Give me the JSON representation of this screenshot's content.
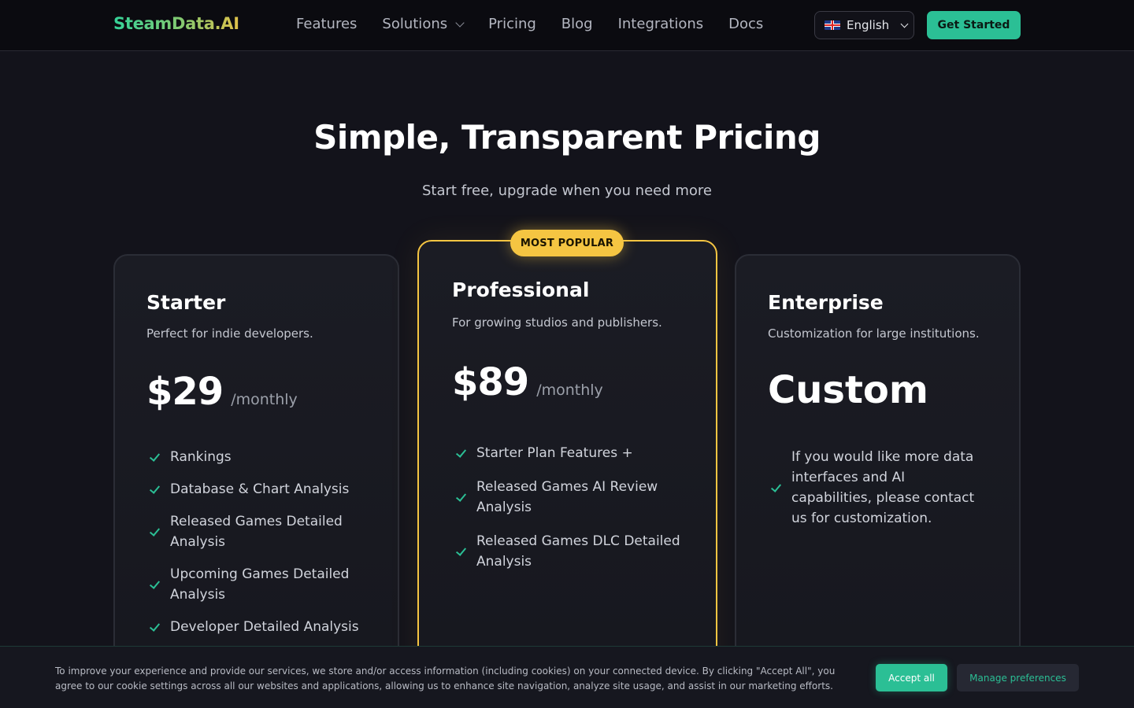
{
  "nav": {
    "logo": "SteamData.AI",
    "links": [
      "Features",
      "Solutions",
      "Pricing",
      "Blog",
      "Integrations",
      "Docs"
    ],
    "language": "English",
    "cta": "Get Started"
  },
  "hero": {
    "title": "Simple, Transparent Pricing",
    "subtitle": "Start free, upgrade when you need more"
  },
  "plans": {
    "starter": {
      "name": "Starter",
      "description": "Perfect for indie developers.",
      "price": "$29",
      "period": "/monthly",
      "features": [
        "Rankings",
        "Database & Chart Analysis",
        "Released Games Detailed Analysis",
        "Upcoming Games Detailed Analysis",
        "Developer Detailed Analysis"
      ]
    },
    "professional": {
      "badge": "MOST POPULAR",
      "name": "Professional",
      "description": "For growing studios and publishers.",
      "price": "$89",
      "period": "/monthly",
      "features": [
        "Starter Plan Features +",
        "Released Games AI Review Analysis",
        "Released Games DLC Detailed Analysis"
      ]
    },
    "enterprise": {
      "name": "Enterprise",
      "description": "Customization for large institutions.",
      "price": "Custom",
      "features": [
        "If you would like more data interfaces and AI capabilities, please contact us for customization."
      ]
    }
  },
  "cookie": {
    "text": "To improve your experience and provide our services, we store and/or access information (including cookies) on your connected device. By clicking \"Accept All\", you agree to our cookie settings across all our websites and applications, allowing us to enhance site navigation, analyze site usage, and assist in our marketing efforts.",
    "accept": "Accept all",
    "manage": "Manage preferences"
  },
  "colors": {
    "accent": "#2bbf95",
    "highlight": "#f5c542",
    "background": "#13131b"
  }
}
